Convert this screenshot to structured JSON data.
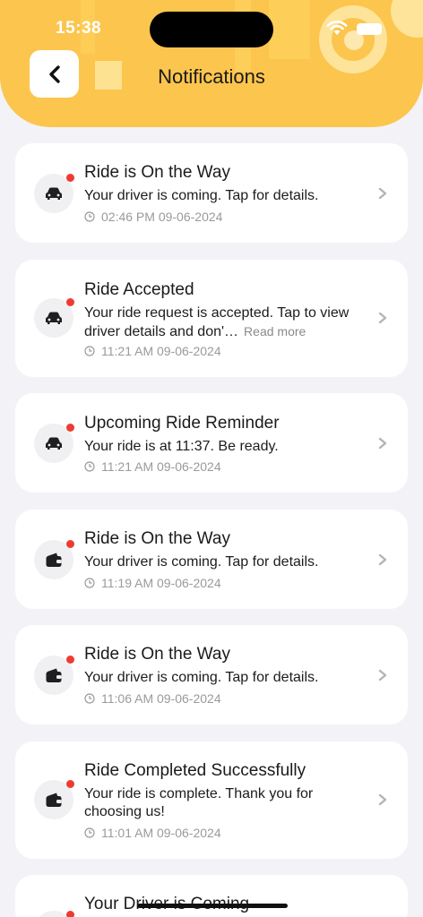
{
  "status_bar": {
    "time": "15:38"
  },
  "header": {
    "title": "Notifications"
  },
  "notifications": [
    {
      "title": "Ride is On the Way",
      "body": "Your driver is coming. Tap for details.",
      "read_more": "",
      "time": "02:46 PM 09-06-2024",
      "icon": "car-icon"
    },
    {
      "title": "Ride Accepted",
      "body": "Your ride request is accepted. Tap to view driver details and don'…",
      "read_more": "Read more",
      "time": "11:21 AM 09-06-2024",
      "icon": "car-icon"
    },
    {
      "title": "Upcoming Ride Reminder",
      "body": "Your ride is at 11:37. Be ready.",
      "read_more": "",
      "time": "11:21 AM 09-06-2024",
      "icon": "car-icon"
    },
    {
      "title": "Ride is On the Way",
      "body": "Your driver is coming. Tap for details.",
      "read_more": "",
      "time": "11:19 AM 09-06-2024",
      "icon": "wallet-icon"
    },
    {
      "title": "Ride is On the Way",
      "body": "Your driver is coming. Tap for details.",
      "read_more": "",
      "time": "11:06 AM 09-06-2024",
      "icon": "wallet-icon"
    },
    {
      "title": "Ride Completed Successfully",
      "body": "Your ride is complete. Thank you for choosing us!",
      "read_more": "",
      "time": "11:01 AM 09-06-2024",
      "icon": "wallet-icon"
    },
    {
      "title": "Your Driver is Coming",
      "body": "",
      "read_more": "",
      "time": "",
      "icon": "car-icon"
    }
  ],
  "colors": {
    "header": "#fcc54d",
    "unread_dot": "#ee3b32",
    "background": "#f3f3f7"
  }
}
